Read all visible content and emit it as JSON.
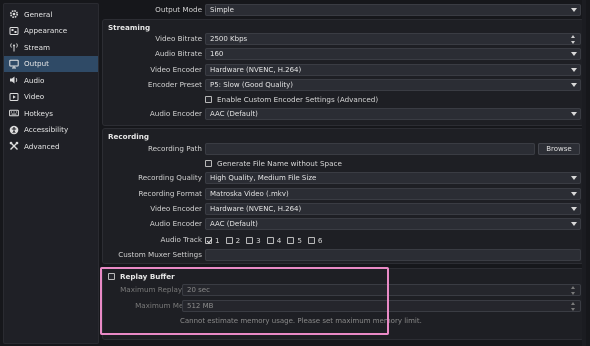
{
  "sidebar": {
    "items": [
      {
        "label": "General",
        "icon": "gear-icon"
      },
      {
        "label": "Appearance",
        "icon": "palette-icon"
      },
      {
        "label": "Stream",
        "icon": "antenna-icon"
      },
      {
        "label": "Output",
        "icon": "monitor-icon"
      },
      {
        "label": "Audio",
        "icon": "speaker-icon"
      },
      {
        "label": "Video",
        "icon": "video-icon"
      },
      {
        "label": "Hotkeys",
        "icon": "keyboard-icon"
      },
      {
        "label": "Accessibility",
        "icon": "accessibility-icon"
      },
      {
        "label": "Advanced",
        "icon": "tools-icon"
      }
    ],
    "active": "Output"
  },
  "output_mode": {
    "label": "Output Mode",
    "value": "Simple"
  },
  "streaming": {
    "title": "Streaming",
    "video_bitrate": {
      "label": "Video Bitrate",
      "value": "2500 Kbps"
    },
    "audio_bitrate": {
      "label": "Audio Bitrate",
      "value": "160"
    },
    "video_encoder": {
      "label": "Video Encoder",
      "value": "Hardware (NVENC, H.264)"
    },
    "encoder_preset": {
      "label": "Encoder Preset",
      "value": "P5: Slow (Good Quality)"
    },
    "custom_encoder": {
      "label": "Enable Custom Encoder Settings (Advanced)",
      "checked": false
    },
    "audio_encoder": {
      "label": "Audio Encoder",
      "value": "AAC (Default)"
    }
  },
  "recording": {
    "title": "Recording",
    "path": {
      "label": "Recording Path",
      "value": "",
      "browse": "Browse"
    },
    "gen_filename": {
      "label": "Generate File Name without Space",
      "checked": false
    },
    "quality": {
      "label": "Recording Quality",
      "value": "High Quality, Medium File Size"
    },
    "format": {
      "label": "Recording Format",
      "value": "Matroska Video (.mkv)"
    },
    "video_encoder": {
      "label": "Video Encoder",
      "value": "Hardware (NVENC, H.264)"
    },
    "audio_encoder": {
      "label": "Audio Encoder",
      "value": "AAC (Default)"
    },
    "audio_track": {
      "label": "Audio Track",
      "tracks": [
        "1",
        "2",
        "3",
        "4",
        "5",
        "6"
      ],
      "checked": [
        true,
        false,
        false,
        false,
        false,
        false
      ]
    },
    "muxer": {
      "label": "Custom Muxer Settings",
      "value": ""
    }
  },
  "replay": {
    "title": "Replay Buffer",
    "checked": false,
    "max_time": {
      "label": "Maximum Replay Time",
      "value": "20 sec"
    },
    "max_memory": {
      "label": "Maximum Memory",
      "value": "512 MB"
    },
    "warning": "Cannot estimate memory usage. Please set maximum memory limit."
  },
  "colors": {
    "highlight": "#e98ac6",
    "active_nav": "#2f4a66"
  }
}
